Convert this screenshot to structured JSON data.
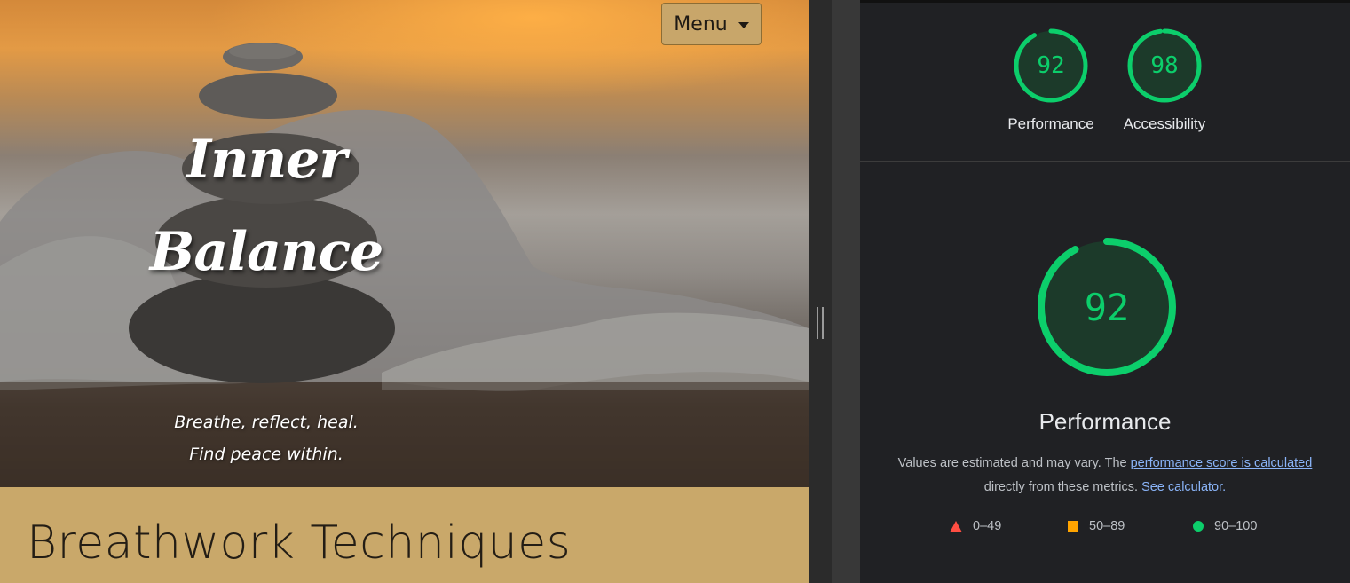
{
  "site": {
    "menu_label": "Menu",
    "title_line1": "Inner",
    "title_line2": "Balance",
    "tagline_line1": "Breathe, reflect, heal.",
    "tagline_line2": "Find peace within.",
    "section_heading": "Breathwork Techniques"
  },
  "lighthouse": {
    "scores": [
      {
        "label": "Performance",
        "value": "92",
        "fraction": 0.92
      },
      {
        "label": "Accessibility",
        "value": "98",
        "fraction": 0.98
      }
    ],
    "main": {
      "value": "92",
      "fraction": 0.92,
      "title": "Performance",
      "desc_prefix": "Values are estimated and may vary. The ",
      "desc_link1": "performance score is calculated",
      "desc_middle": "directly from these metrics. ",
      "desc_link2": "See calculator."
    },
    "legend": [
      {
        "range": "0–49",
        "icon": "triangle-icon",
        "color": "#ff4e42"
      },
      {
        "range": "50–89",
        "icon": "square-icon",
        "color": "#ffa400"
      },
      {
        "range": "90–100",
        "icon": "circle-icon",
        "color": "#0cce6b"
      }
    ],
    "colors": {
      "pass": "#0cce6b",
      "pass_bg": "#1c3a2a",
      "panel_bg": "#202124",
      "site_accent": "#c8a66a"
    }
  }
}
